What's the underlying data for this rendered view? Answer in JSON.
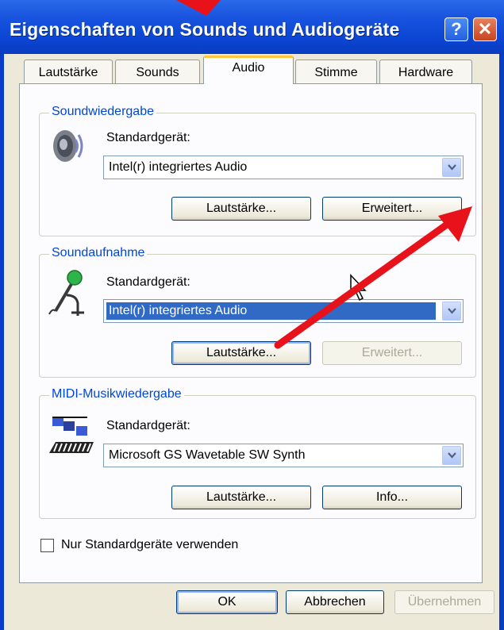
{
  "window": {
    "title": "Eigenschaften von Sounds und Audiogeräte",
    "help_label": "?",
    "close_label": "✕"
  },
  "tabs": [
    {
      "label": "Lautstärke"
    },
    {
      "label": "Sounds"
    },
    {
      "label": "Audio"
    },
    {
      "label": "Stimme"
    },
    {
      "label": "Hardware"
    }
  ],
  "playback": {
    "legend": "Soundwiedergabe",
    "device_label": "Standardgerät:",
    "device_value": "Intel(r) integriertes Audio",
    "volume_button": "Lautstärke...",
    "advanced_button": "Erweitert..."
  },
  "recording": {
    "legend": "Soundaufnahme",
    "device_label": "Standardgerät:",
    "device_value": "Intel(r) integriertes Audio",
    "volume_button": "Lautstärke...",
    "advanced_button": "Erweitert..."
  },
  "midi": {
    "legend": "MIDI-Musikwiedergabe",
    "device_label": "Standardgerät:",
    "device_value": "Microsoft GS Wavetable SW Synth",
    "volume_button": "Lautstärke...",
    "info_button": "Info..."
  },
  "checkbox": {
    "label": "Nur Standardgeräte verwenden",
    "checked": false
  },
  "footer": {
    "ok": "OK",
    "cancel": "Abbrechen",
    "apply": "Übernehmen"
  },
  "icons": [
    "speaker-icon",
    "microphone-icon",
    "midi-keyboard-icon",
    "dropdown-arrow-icon",
    "help-icon",
    "close-icon",
    "mouse-cursor-icon",
    "red-annotation-arrow"
  ],
  "colors": {
    "title_bar": "#0b46d4",
    "legend": "#0046d5",
    "selection": "#316ac5",
    "annotation": "#e8121a",
    "active_tab_accent": "#ffc83c"
  }
}
